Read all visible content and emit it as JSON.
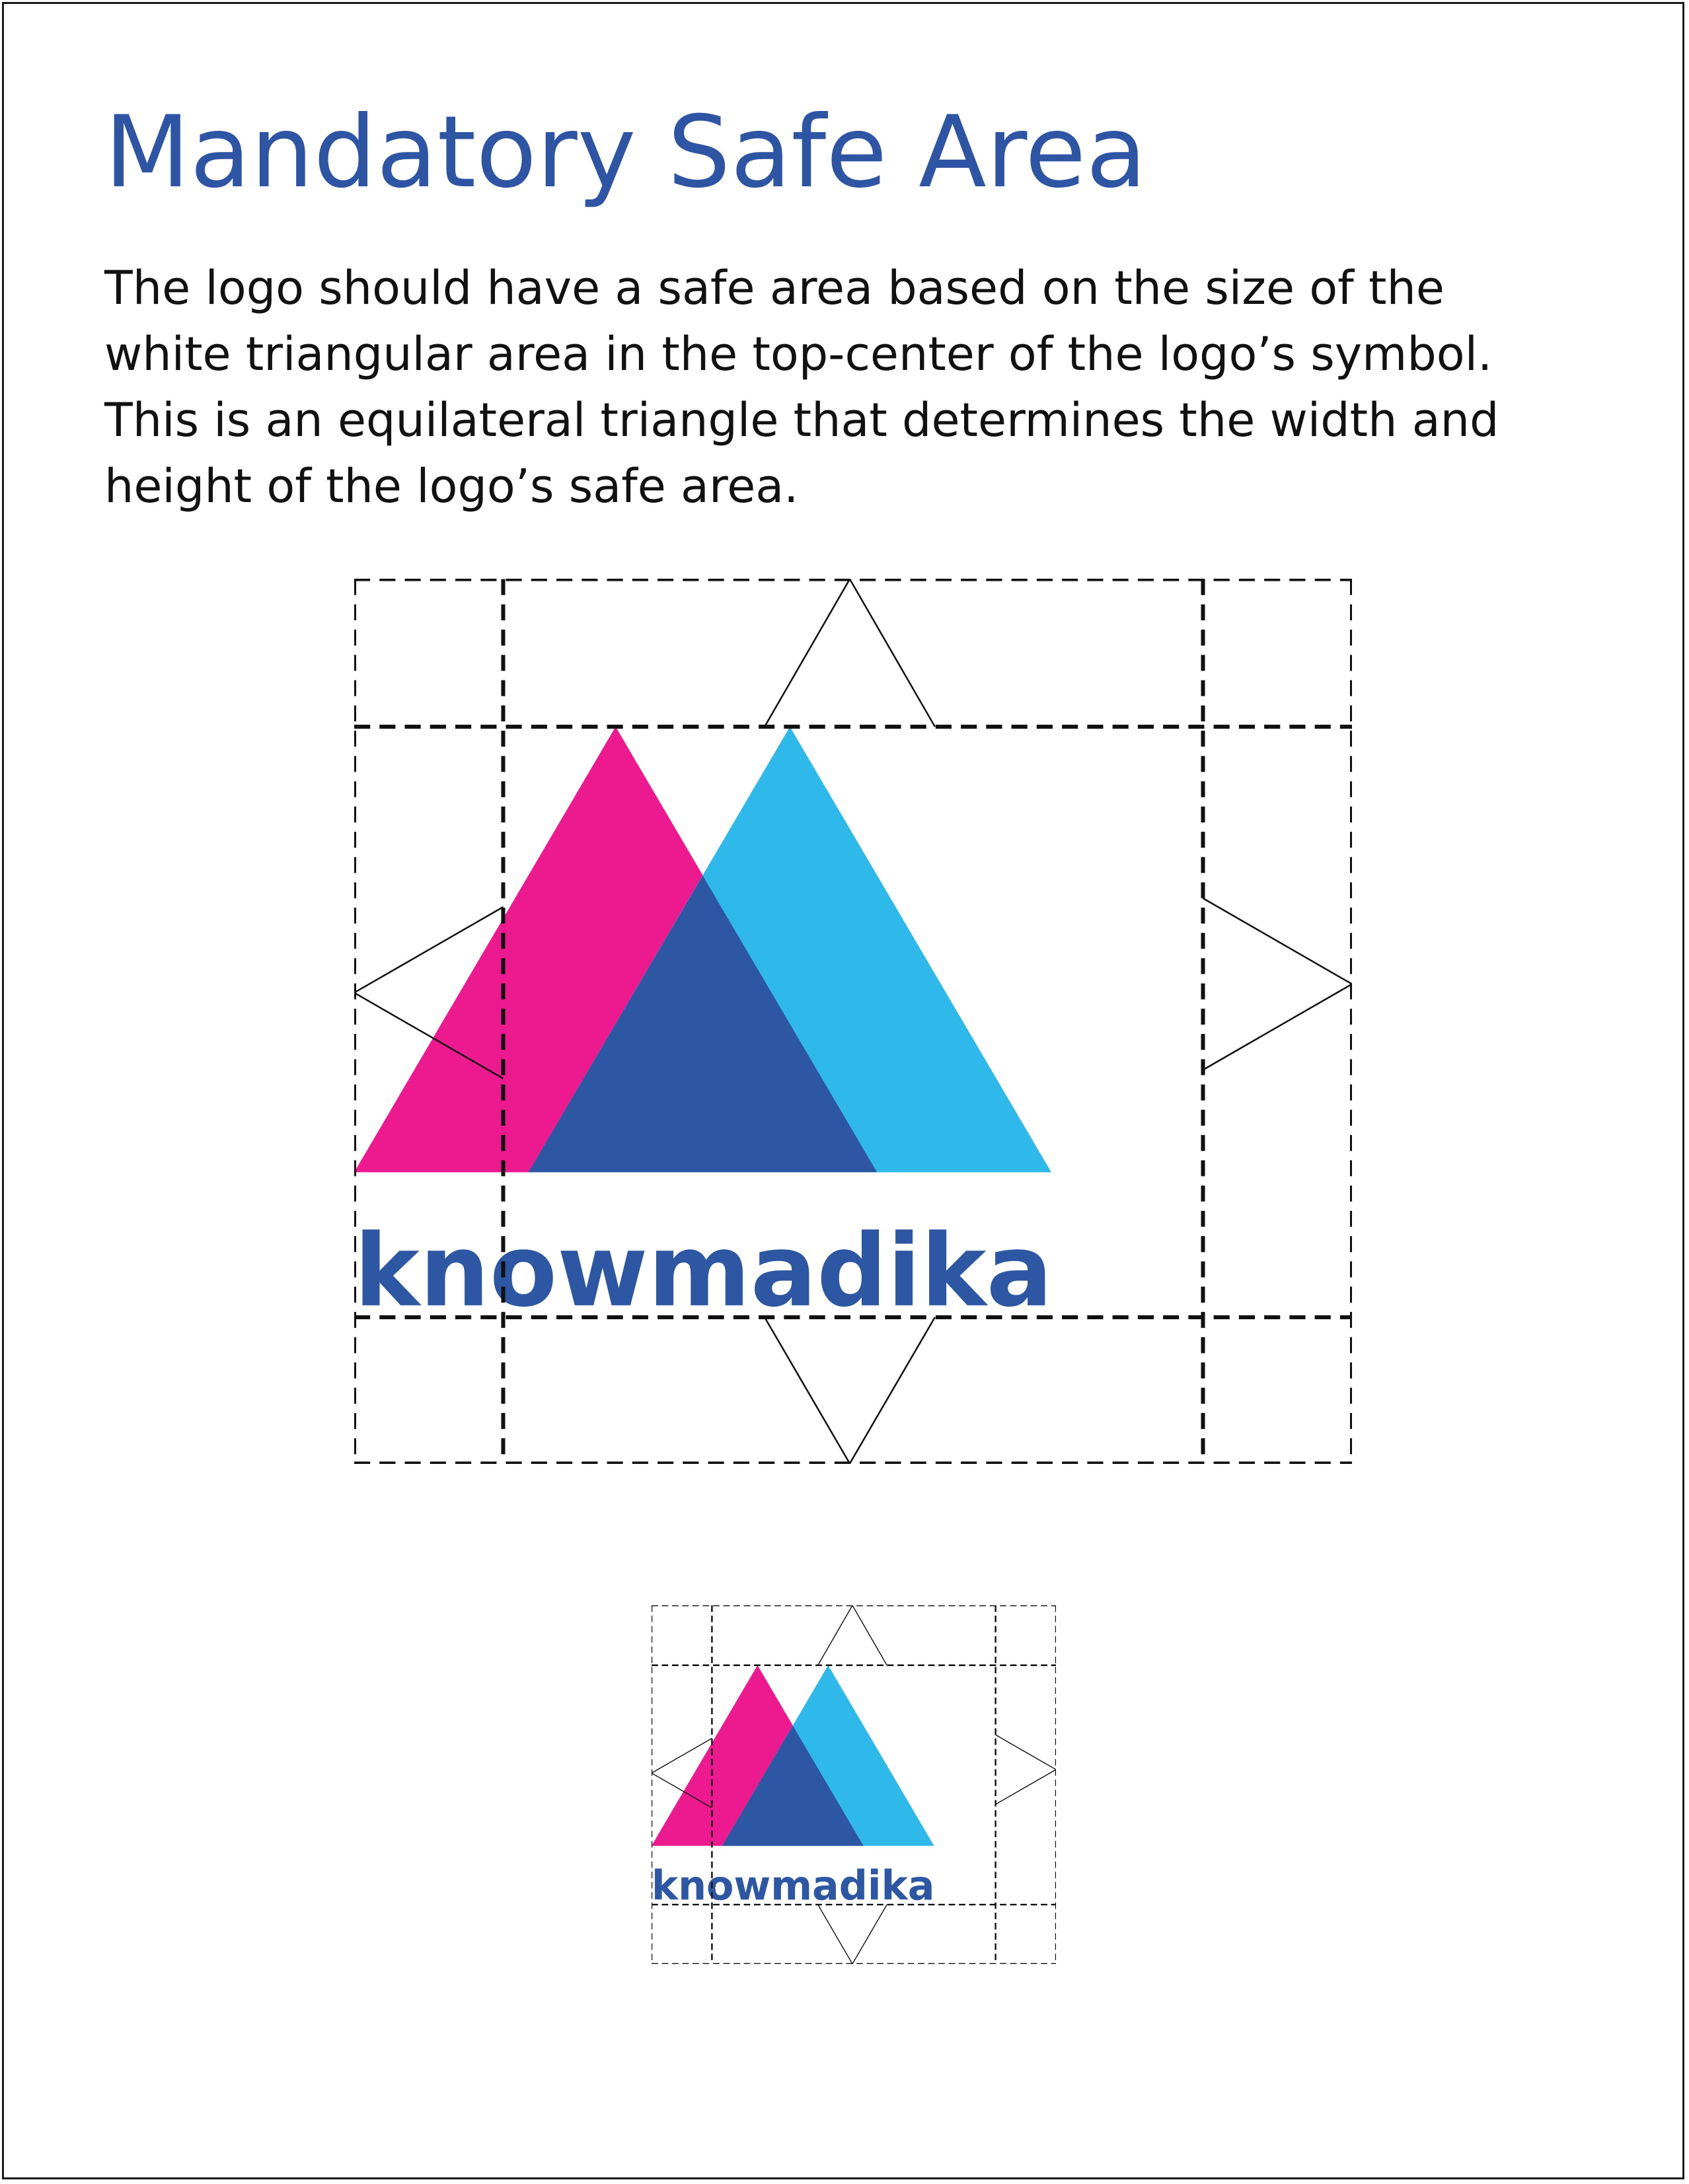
{
  "page": {
    "title": "Mandatory Safe Area",
    "body_lines": [
      "The logo should have a safe area based on the size of the",
      "white triangular area in the top-center of the logo’s symbol.",
      "This is an equilateral triangle that determines the width and",
      "height of the logo’s safe area."
    ]
  },
  "logo": {
    "wordmark": "knowmadika",
    "colors": {
      "magenta": "#ec1a8e",
      "cyan": "#2fb8ea",
      "navy": "#2d56a3",
      "wordmark": "#2d56a3",
      "guide": "#111111"
    }
  }
}
